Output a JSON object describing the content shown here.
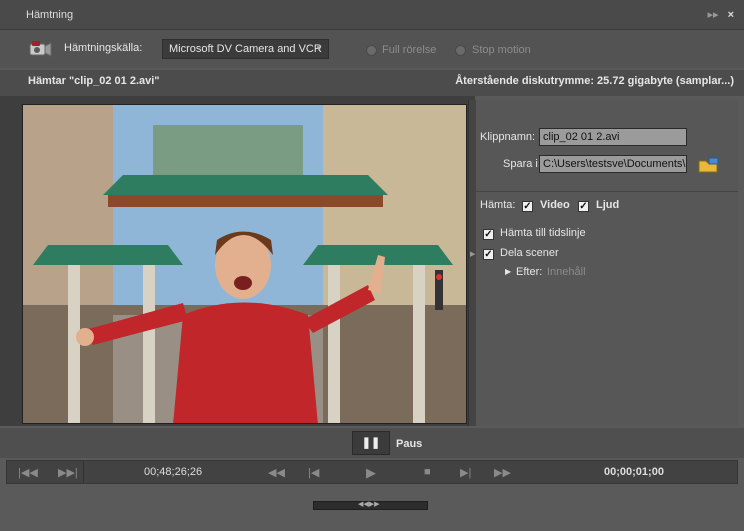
{
  "window": {
    "title": "Hämtning",
    "buttons": [
      "▸▸",
      "×"
    ]
  },
  "source": {
    "label": "Hämtningskälla:",
    "device": "Microsoft DV Camera and VCR",
    "options": [
      "Full rörelse",
      "Stop motion"
    ]
  },
  "status": {
    "capturing": "Hämtar \"clip_02 01 2.avi\"",
    "disk_space": "Återstående diskutrymme: 25.72 gigabyte (samplar...)"
  },
  "form": {
    "clip_name_label": "Klippnamn:",
    "clip_name": "clip_02 01 2.avi",
    "save_in_label": "Spara i:",
    "save_in": "C:\\Users\\testsve\\Documents\\",
    "capture_label": "Hämta:",
    "video_label": "Video",
    "audio_label": "Ljud",
    "to_timeline_label": "Hämta till tidslinje",
    "split_scenes_label": "Dela scener",
    "after_label": "Efter:",
    "after_value": "Innehåll"
  },
  "controls": {
    "pause_label": "Paus",
    "timecode_current": "00;48;26;26",
    "timecode_duration": "00;00;01;00"
  },
  "colors": {
    "background": "#5a5a5a",
    "panel": "#575757",
    "video_bg": "#111111"
  },
  "icons": [
    "camcorder-icon",
    "folder-icon",
    "pause-icon",
    "play-icon",
    "stop-icon",
    "rewind-icon",
    "step-back-icon",
    "step-forward-icon",
    "goto-start-icon",
    "goto-end-icon",
    "chevron-right-icon",
    "check-icon"
  ]
}
